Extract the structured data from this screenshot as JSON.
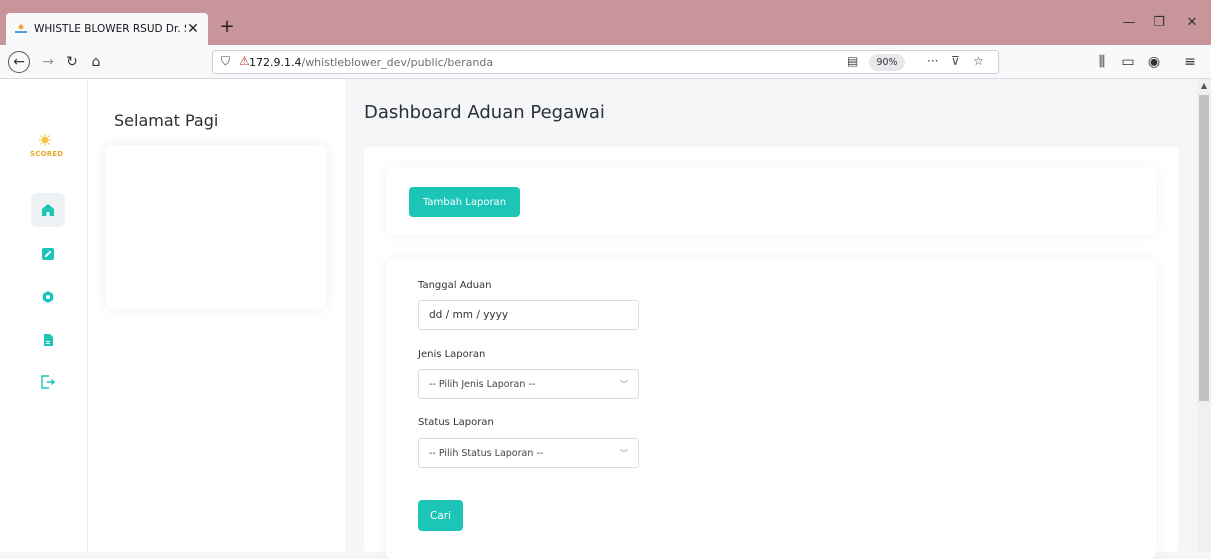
{
  "browser": {
    "tab_title": "WHISTLE BLOWER RSUD Dr. So",
    "url_host": "172.9.1.4",
    "url_path": "/whistleblower_dev/public/beranda",
    "zoom": "90%"
  },
  "sidebar": {
    "logo_text": "SCORED",
    "icons": [
      "home-icon",
      "edit-icon",
      "hexagon-icon",
      "document-icon",
      "logout-icon"
    ],
    "accent_color": "#1cc5b7"
  },
  "greeting": {
    "title": "Selamat Pagi"
  },
  "main": {
    "title": "Dashboard Aduan Pegawai",
    "add_button": "Tambah Laporan",
    "filters": {
      "date_label": "Tanggal Aduan",
      "date_placeholder": "dd / mm / yyyy",
      "type_label": "Jenis Laporan",
      "type_selected": "-- Pilih Jenis Laporan --",
      "status_label": "Status Laporan",
      "status_selected": "-- Pilih Status Laporan --",
      "search_button": "Cari"
    }
  }
}
